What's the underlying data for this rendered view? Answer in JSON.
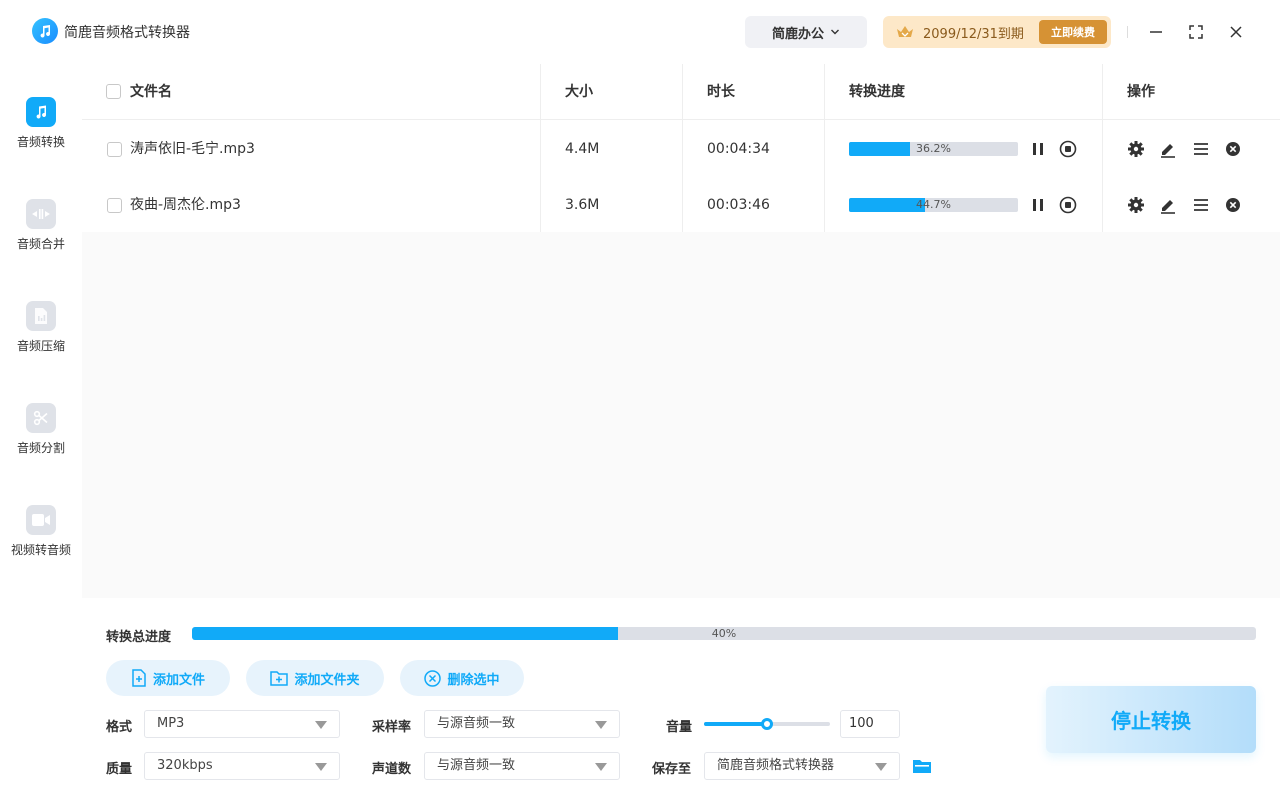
{
  "app": {
    "title": "简鹿音频格式转换器",
    "brand_menu": "简鹿办公",
    "vip_date": "2099/12/31到期",
    "renew_label": "立即续费"
  },
  "sidebar": {
    "items": [
      {
        "label": "音频转换",
        "icon": "music-note-icon",
        "active": true
      },
      {
        "label": "音频合并",
        "icon": "merge-icon",
        "active": false
      },
      {
        "label": "音频压缩",
        "icon": "compress-file-icon",
        "active": false
      },
      {
        "label": "音频分割",
        "icon": "scissors-icon",
        "active": false
      },
      {
        "label": "视频转音频",
        "icon": "video-camera-icon",
        "active": false
      }
    ]
  },
  "table": {
    "headers": {
      "name": "文件名",
      "size": "大小",
      "duration": "时长",
      "progress": "转换进度",
      "actions": "操作"
    },
    "rows": [
      {
        "name": "涛声依旧-毛宁.mp3",
        "size": "4.4M",
        "duration": "00:04:34",
        "progress": 36.2,
        "progress_text": "36.2%"
      },
      {
        "name": "夜曲-周杰伦.mp3",
        "size": "3.6M",
        "duration": "00:03:46",
        "progress": 44.7,
        "progress_text": "44.7%"
      }
    ]
  },
  "bottom": {
    "total_label": "转换总进度",
    "total_progress": 40,
    "total_progress_text": "40%",
    "add_file": "添加文件",
    "add_folder": "添加文件夹",
    "delete_selected": "删除选中",
    "format_label": "格式",
    "format_value": "MP3",
    "quality_label": "质量",
    "quality_value": "320kbps",
    "sample_rate_label": "采样率",
    "sample_rate_value": "与源音频一致",
    "channels_label": "声道数",
    "channels_value": "与源音频一致",
    "volume_label": "音量",
    "volume_value": "100",
    "volume_level": 0.5,
    "save_label": "保存至",
    "save_value": "简鹿音频格式转换器",
    "stop_label": "停止转换"
  },
  "colors": {
    "accent": "#11aaf8",
    "vip_bg": "#fde8c8",
    "renew_bg": "#d69234"
  }
}
